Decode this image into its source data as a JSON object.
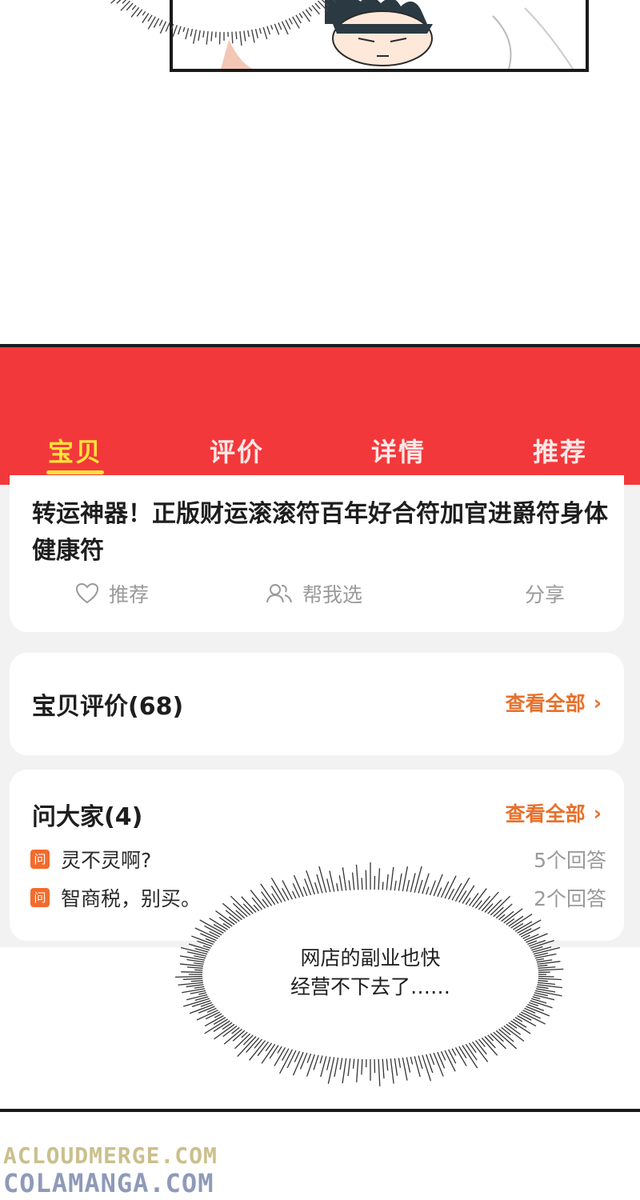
{
  "tabs": [
    {
      "label": "宝贝",
      "active": true
    },
    {
      "label": "评价",
      "active": false
    },
    {
      "label": "详情",
      "active": false
    },
    {
      "label": "推荐",
      "active": false
    }
  ],
  "product": {
    "title": "转运神器！正版财运滚滚符百年好合符加官进爵符身体健康符",
    "actions": {
      "recommend": "推荐",
      "help_choose": "帮我选",
      "share": "分享"
    }
  },
  "reviews": {
    "title": "宝贝评价(68)",
    "see_all": "查看全部"
  },
  "qa": {
    "title": "问大家(4)",
    "see_all": "查看全部",
    "badge": "问",
    "questions": [
      {
        "text": "灵不灵啊?",
        "answers": "5个回答"
      },
      {
        "text": "智商税，别买。",
        "answers": "2个回答"
      }
    ]
  },
  "speech": {
    "line1": "网店的副业也快",
    "line2": "经营不下去了……"
  },
  "watermark": {
    "line1": "ACLOUDMERGE.COM",
    "line2": "COLAMANGA.COM"
  },
  "colors": {
    "header_red": "#f3383c",
    "active_tab": "#ffe23a",
    "accent_orange": "#e8702a"
  }
}
